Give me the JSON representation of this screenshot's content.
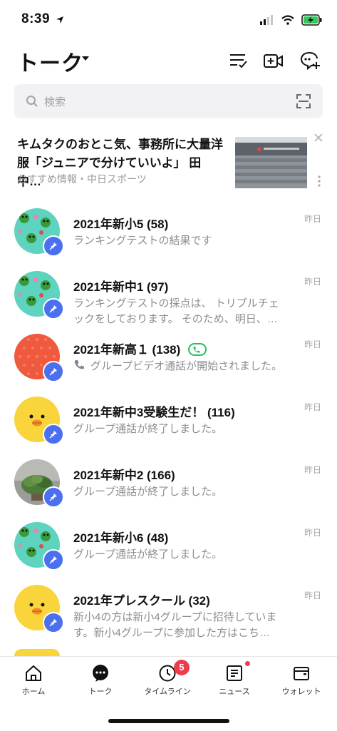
{
  "status": {
    "time": "8:39"
  },
  "header": {
    "title": "トーク"
  },
  "search": {
    "placeholder": "検索"
  },
  "news": {
    "headline": "キムタクのおとこ気、事務所に大量洋服「ジュニアで分けていいよ」 田中…",
    "source": "おすすめ情報・中日スポーツ"
  },
  "chats": [
    {
      "name": "2021年新小5 (58)",
      "message": "ランキングテストの結果です",
      "time": "昨日",
      "avatar": "frog-pattern"
    },
    {
      "name": "2021年新中1 (97)",
      "message": "ランキングテストの採点は、 トリプルチェックをしております。 そのため、明日、…",
      "time": "昨日",
      "avatar": "frog-pattern"
    },
    {
      "name": "2021年新高１ (138)",
      "message": "グループビデオ通話が開始されました。",
      "time": "昨日",
      "avatar": "red-pattern"
    },
    {
      "name": "2021年新中3受験生だ！ (116)",
      "message": "グループ通話が終了しました。",
      "time": "昨日",
      "avatar": "chick"
    },
    {
      "name": "2021年新中2 (166)",
      "message": "グループ通話が終了しました。",
      "time": "昨日",
      "avatar": "plant"
    },
    {
      "name": "2021年新小6 (48)",
      "message": "グループ通話が終了しました。",
      "time": "昨日",
      "avatar": "frog-pattern"
    },
    {
      "name": "2021年プレスクール (32)",
      "message": "新小4の方は新小4グループに招待しています。新小4グループに参加した方はこち…",
      "time": "昨日",
      "avatar": "chick"
    }
  ],
  "tabbar": {
    "home": "ホーム",
    "talk": "トーク",
    "timeline": "タイムライン",
    "timeline_badge": "5",
    "news": "ニュース",
    "wallet": "ウォレット"
  },
  "colors": {
    "accent": "#4a6ff0",
    "badge": "#ef3b4d",
    "call_green": "#21c25e"
  }
}
